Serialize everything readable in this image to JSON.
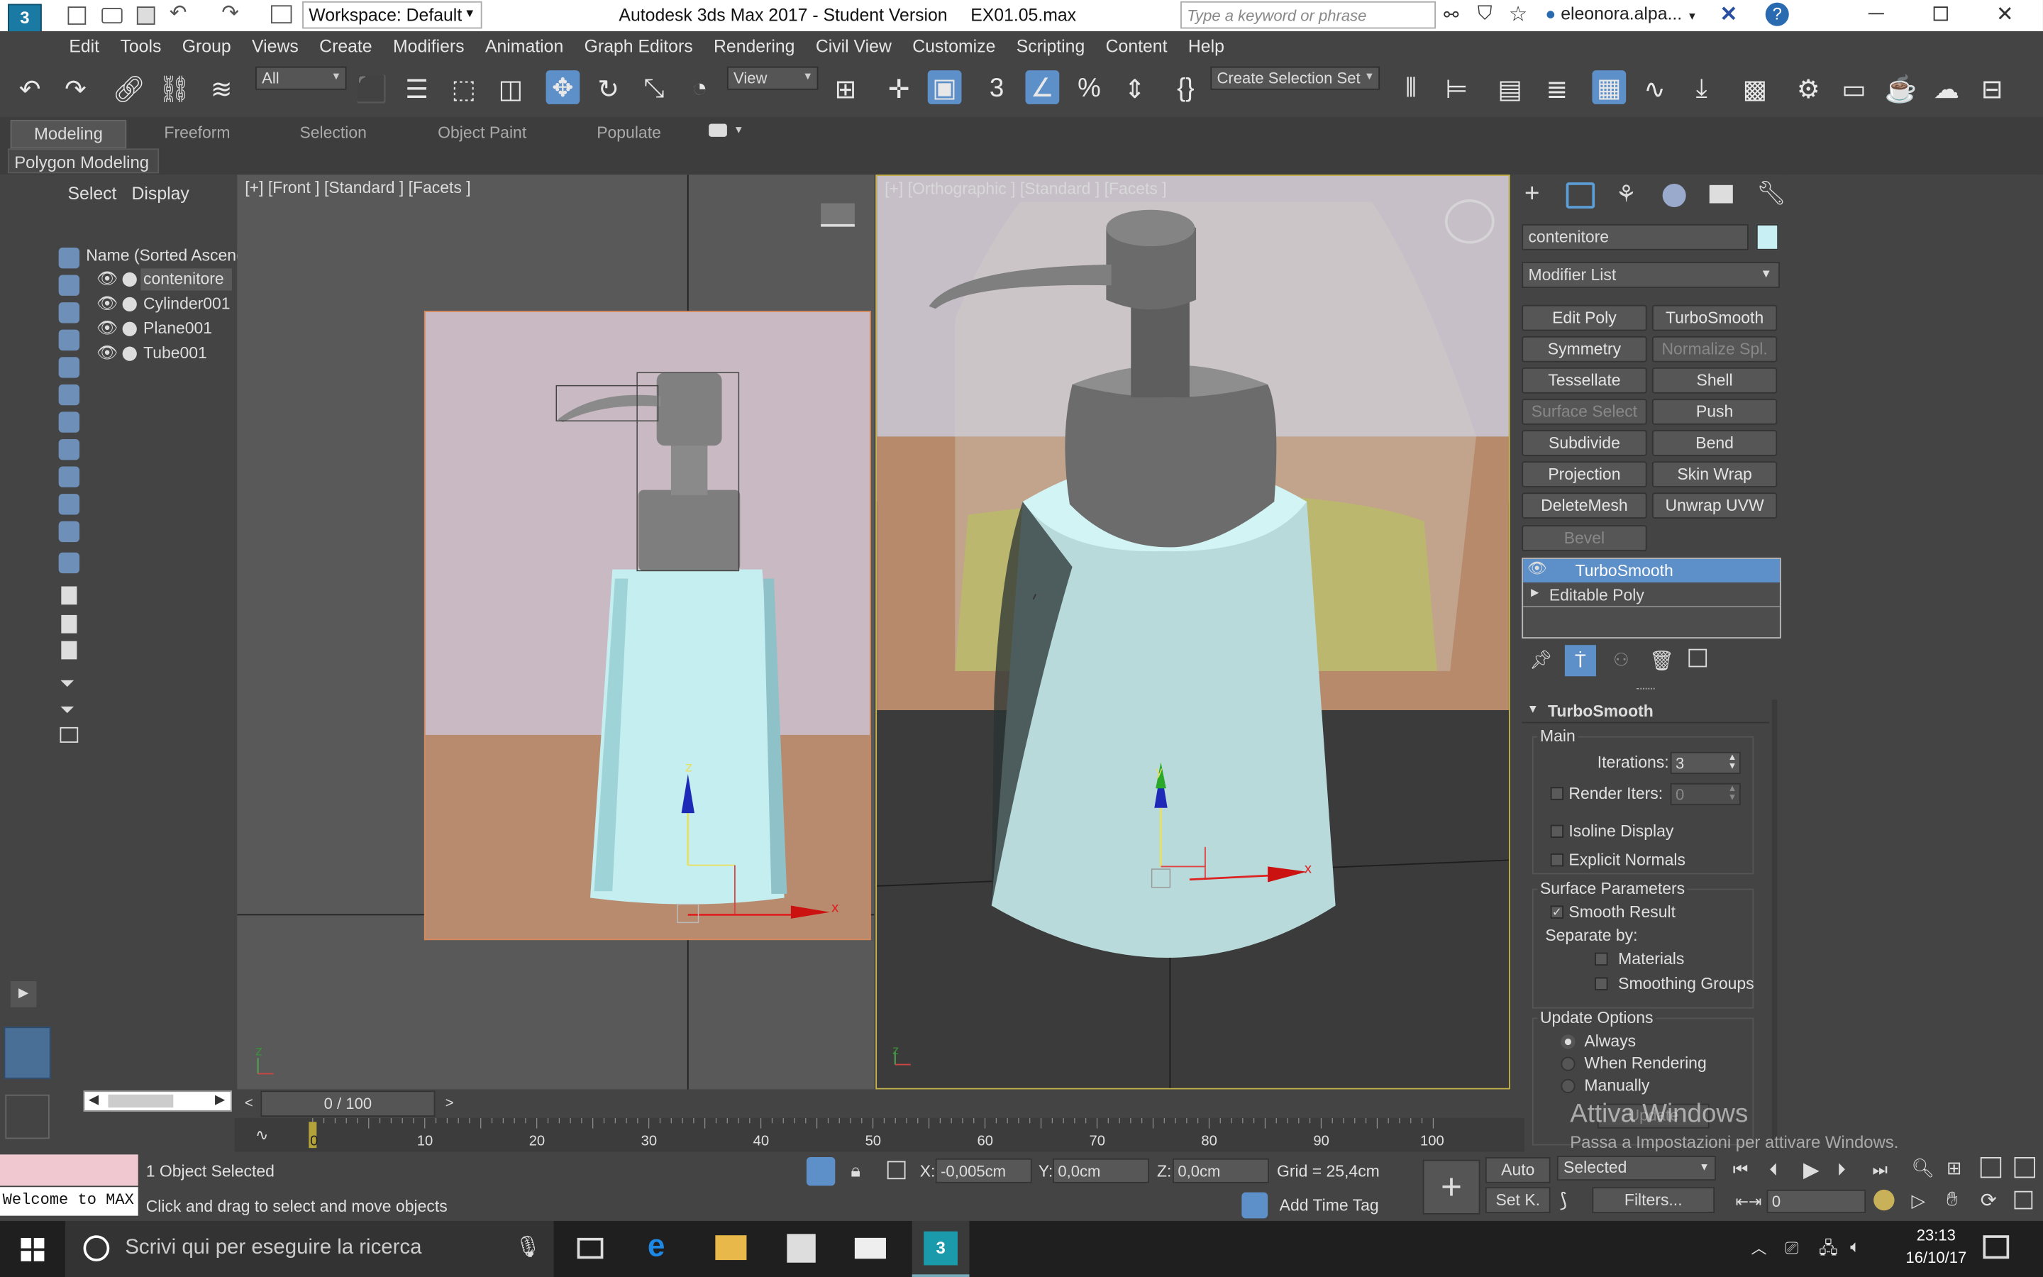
{
  "title_bar": {
    "workspace": "Workspace: Default",
    "title": "Autodesk 3ds Max 2017 - Student Version",
    "file": "EX01.05.max",
    "search_placeholder": "Type a keyword or phrase",
    "user": "eleonora.alpa...",
    "help": "?"
  },
  "menu": [
    "Edit",
    "Tools",
    "Group",
    "Views",
    "Create",
    "Modifiers",
    "Animation",
    "Graph Editors",
    "Rendering",
    "Civil View",
    "Customize",
    "Scripting",
    "Content",
    "Help"
  ],
  "toolbar": {
    "filter_value": "All",
    "refcoord_value": "View",
    "selection_set_value": "Create Selection Set"
  },
  "ribbon": {
    "tabs": [
      "Modeling",
      "Freeform",
      "Selection",
      "Object Paint",
      "Populate"
    ],
    "active_tab": "Modeling",
    "subpanel": "Polygon Modeling"
  },
  "scene_explorer": {
    "tabs": [
      "Select",
      "Display"
    ],
    "header": "Name (Sorted Ascend",
    "items": [
      "contenitore",
      "Cylinder001",
      "Plane001",
      "Tube001"
    ],
    "selected": "contenitore"
  },
  "viewports": {
    "left_label": "[+]  [Front ]  [Standard ]  [Facets ]",
    "right_label": "[+]  [Orthographic ]  [Standard ]  [Facets ]"
  },
  "command_panel": {
    "object_name": "contenitore",
    "object_color": "#c8f0f4",
    "modifier_list": "Modifier List",
    "modifier_buttons": [
      {
        "label": "Edit Poly",
        "enabled": true
      },
      {
        "label": "TurboSmooth",
        "enabled": true
      },
      {
        "label": "Symmetry",
        "enabled": true
      },
      {
        "label": "Normalize Spl.",
        "enabled": false
      },
      {
        "label": "Tessellate",
        "enabled": true
      },
      {
        "label": "Shell",
        "enabled": true
      },
      {
        "label": "Surface Select",
        "enabled": false
      },
      {
        "label": "Push",
        "enabled": true
      },
      {
        "label": "Subdivide",
        "enabled": true
      },
      {
        "label": "Bend",
        "enabled": true
      },
      {
        "label": "Projection",
        "enabled": true
      },
      {
        "label": "Skin Wrap",
        "enabled": true
      },
      {
        "label": "DeleteMesh",
        "enabled": true
      },
      {
        "label": "Unwrap UVW",
        "enabled": true
      },
      {
        "label": "Bevel",
        "enabled": false
      }
    ],
    "stack": [
      "TurboSmooth",
      "Editable Poly"
    ],
    "rollout_title": "TurboSmooth",
    "main_label": "Main",
    "iterations_label": "Iterations:",
    "iterations_value": "3",
    "render_iters_label": "Render Iters:",
    "render_iters_value": "0",
    "isoline_label": "Isoline Display",
    "explicit_normals_label": "Explicit Normals",
    "surface_params_label": "Surface Parameters",
    "smooth_result_label": "Smooth Result",
    "separate_by_label": "Separate by:",
    "materials_label": "Materials",
    "smoothing_groups_label": "Smoothing Groups",
    "update_options_label": "Update Options",
    "always_label": "Always",
    "when_rendering_label": "When Rendering",
    "manually_label": "Manually",
    "update_button": "Update"
  },
  "timeline": {
    "frame_display": "0 / 100",
    "ticks": [
      "0",
      "10",
      "20",
      "30",
      "40",
      "50",
      "60",
      "70",
      "80",
      "90",
      "100"
    ]
  },
  "status": {
    "selection": "1 Object Selected",
    "prompt": "Click and drag to select and move objects",
    "maxscript": "Welcome to MAX",
    "x_label": "X:",
    "x_value": "-0,005cm",
    "y_label": "Y:",
    "y_value": "0,0cm",
    "z_label": "Z:",
    "z_value": "0,0cm",
    "grid": "Grid = 25,4cm",
    "add_time_tag": "Add Time Tag",
    "auto_key": "Auto",
    "set_key": "Set K.",
    "key_mode": "Selected",
    "filters": "Filters...",
    "frame": "0"
  },
  "watermark": {
    "line1": "Attiva Windows",
    "line2": "Passa a Impostazioni per attivare Windows."
  },
  "taskbar": {
    "search": "Scrivi qui per eseguire la ricerca",
    "time": "23:13",
    "date": "16/10/17"
  }
}
